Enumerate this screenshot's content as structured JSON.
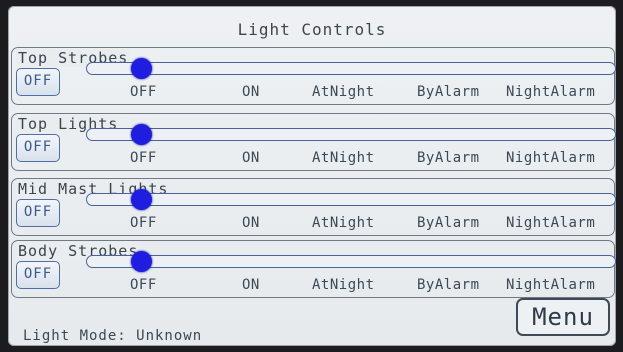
{
  "title": "Light Controls",
  "groups": [
    {
      "label": "Top Strobes",
      "button_label": "OFF",
      "options": [
        "OFF",
        "ON",
        "AtNight",
        "ByAlarm",
        "NightAlarm"
      ],
      "selected": "OFF"
    },
    {
      "label": "Top Lights",
      "button_label": "OFF",
      "options": [
        "OFF",
        "ON",
        "AtNight",
        "ByAlarm",
        "NightAlarm"
      ],
      "selected": "OFF"
    },
    {
      "label": "Mid Mast Lights",
      "button_label": "OFF",
      "options": [
        "OFF",
        "ON",
        "AtNight",
        "ByAlarm",
        "NightAlarm"
      ],
      "selected": "OFF"
    },
    {
      "label": "Body Strobes",
      "button_label": "OFF",
      "options": [
        "OFF",
        "ON",
        "AtNight",
        "ByAlarm",
        "NightAlarm"
      ],
      "selected": "OFF"
    }
  ],
  "footer": {
    "mode_text": "Light Mode: Unknown",
    "menu_label": "Menu"
  },
  "colors": {
    "knob": "#1f1ee0",
    "track_border": "#4a6396",
    "screen_bg": "#e9edf0"
  }
}
